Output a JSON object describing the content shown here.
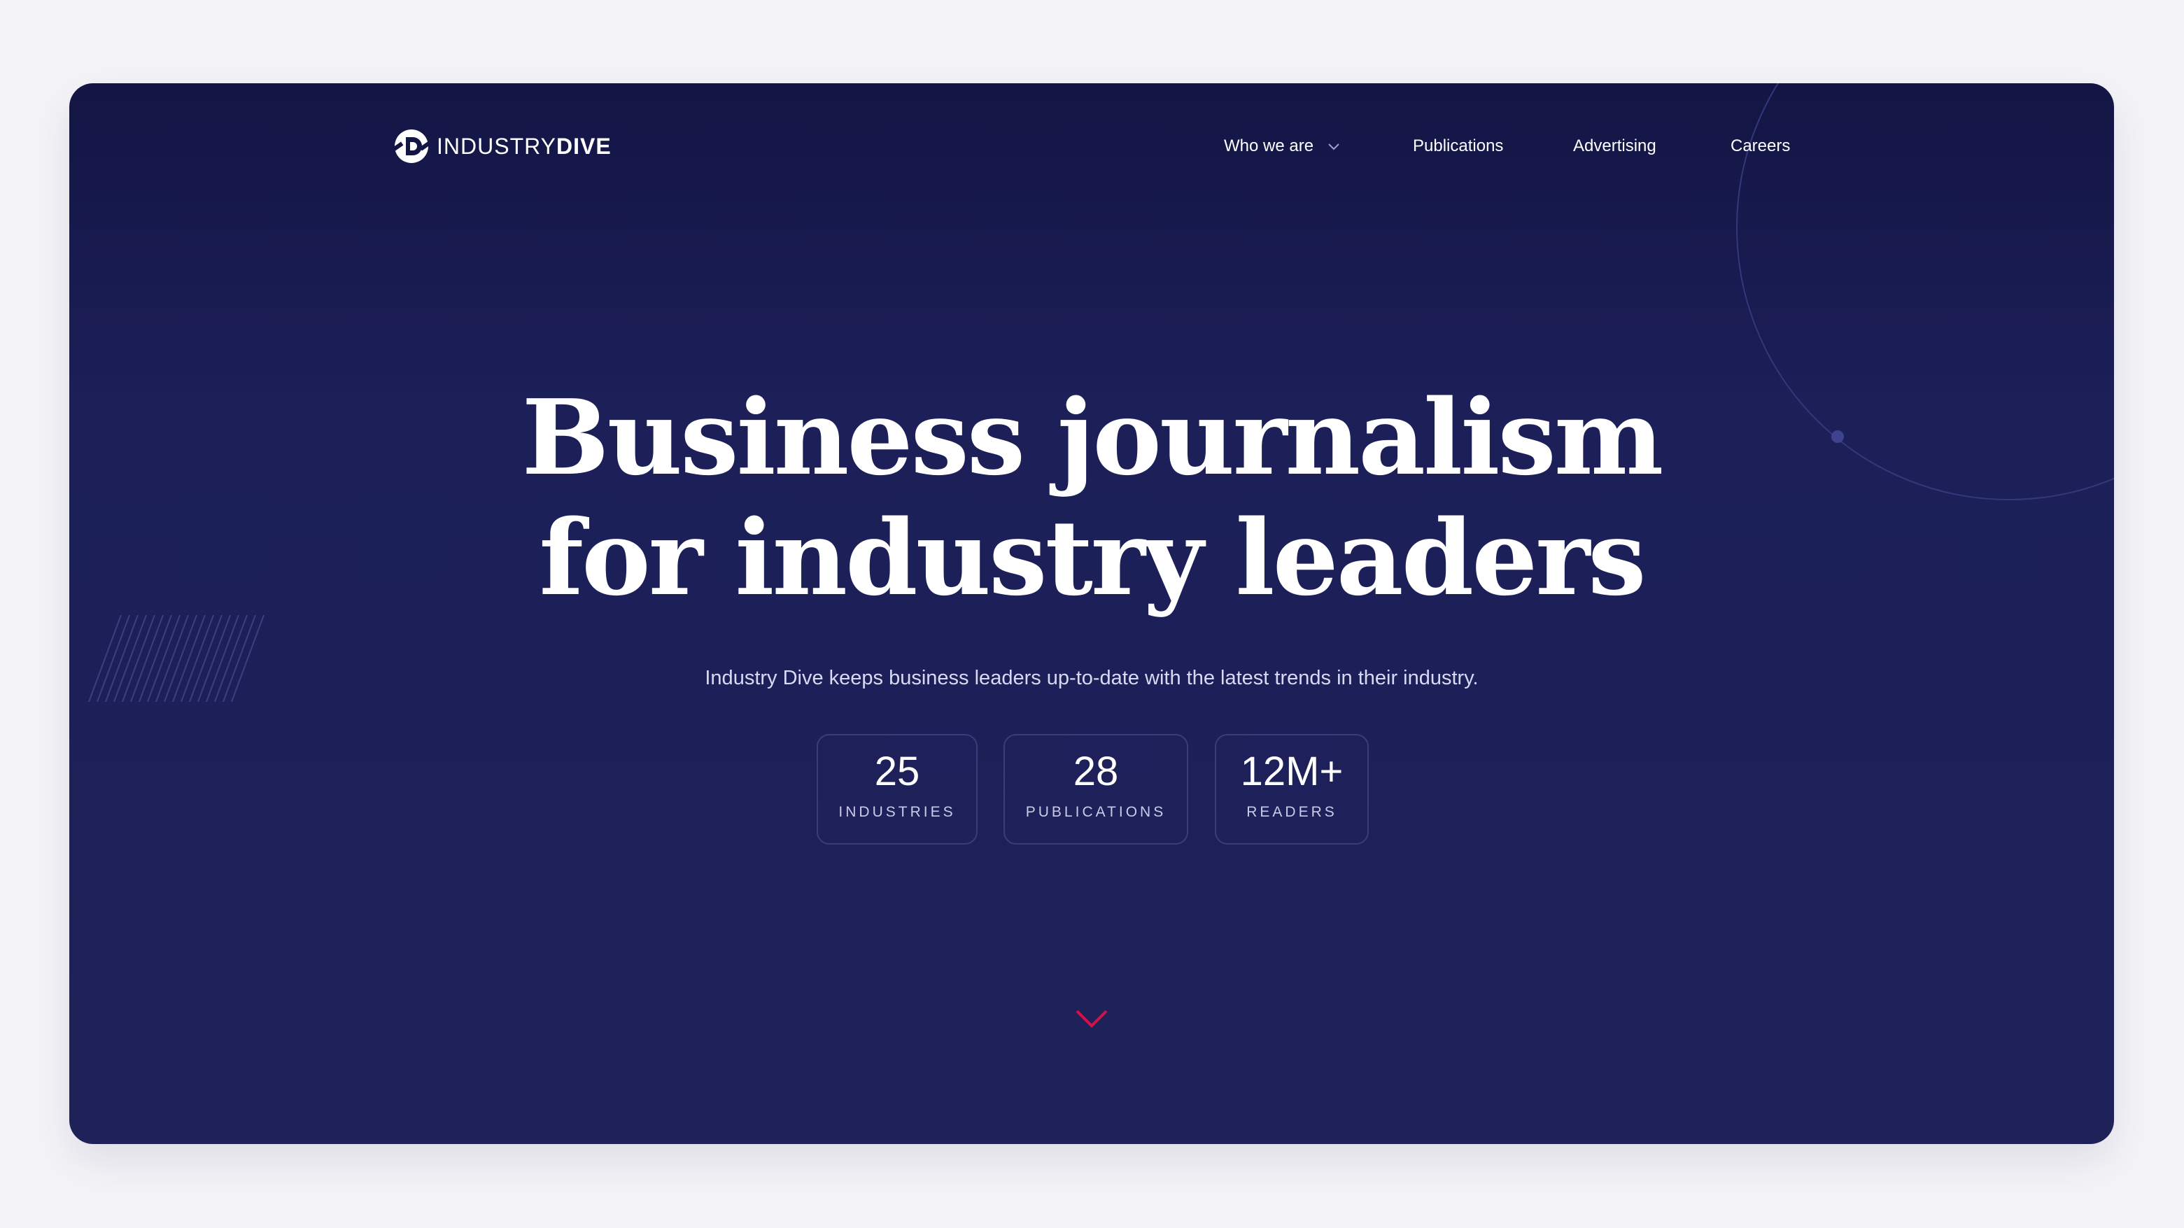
{
  "brand": {
    "logo_text_light": "INDUSTRY",
    "logo_text_bold": "DIVE"
  },
  "nav": {
    "items": [
      {
        "label": "Who we are",
        "has_dropdown": true
      },
      {
        "label": "Publications",
        "has_dropdown": false
      },
      {
        "label": "Advertising",
        "has_dropdown": false
      },
      {
        "label": "Careers",
        "has_dropdown": false
      }
    ]
  },
  "hero": {
    "headline_line1": "Business journalism",
    "headline_line2": "for industry leaders",
    "subheadline": "Industry Dive keeps business leaders up-to-date with the latest trends in their industry.",
    "stats": [
      {
        "value": "25",
        "label": "INDUSTRIES"
      },
      {
        "value": "28",
        "label": "PUBLICATIONS"
      },
      {
        "value": "12M+",
        "label": "READERS"
      }
    ],
    "scroll_icon": "chevron-down-icon"
  },
  "colors": {
    "background": "#f4f4f8",
    "hero_bg_top": "#131544",
    "hero_bg_bottom": "#1f2259",
    "accent": "#d6104a",
    "text": "#ffffff",
    "stat_border": "#3a3d78"
  }
}
